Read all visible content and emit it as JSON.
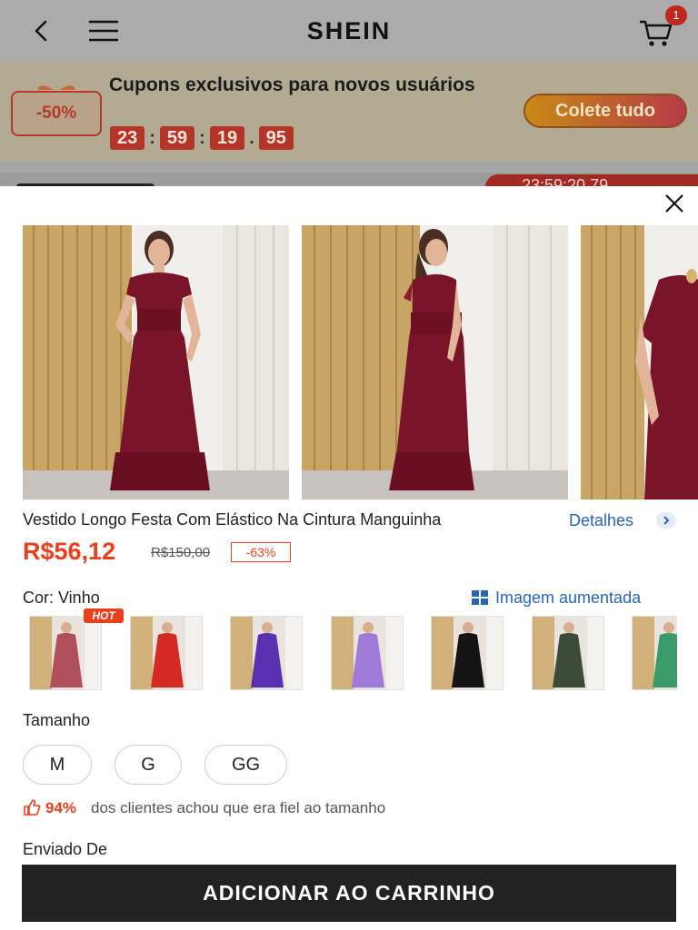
{
  "header": {
    "brand": "SHEIN",
    "cart_count": "1"
  },
  "promo": {
    "tag": "-50%",
    "title": "Cupons exclusivos para novos usuários",
    "countdown": [
      "23",
      "59",
      "19",
      "95"
    ],
    "collect_label": "Colete tudo"
  },
  "background_strip": {
    "timer_text": "23:59:20 79"
  },
  "product": {
    "title": "Vestido Longo Festa Com Elástico Na Cintura Manguinha",
    "details_label": "Detalhes",
    "price": "R$56,12",
    "old_price": "R$150,00",
    "discount": "-63%"
  },
  "color": {
    "label": "Cor: Vinho",
    "zoom_label": "Imagem aumentada",
    "hot_tag": "HOT",
    "swatches": [
      {
        "color": "#b0505c",
        "selected": false
      },
      {
        "color": "#d42a22",
        "selected": false
      },
      {
        "color": "#5a2fb0",
        "selected": false
      },
      {
        "color": "#a07ad8",
        "selected": false
      },
      {
        "color": "#141414",
        "selected": false
      },
      {
        "color": "#3c4a3a",
        "selected": false
      },
      {
        "color": "#3a9a6a",
        "selected": false
      }
    ]
  },
  "size": {
    "label": "Tamanho",
    "options": [
      "M",
      "G",
      "GG"
    ]
  },
  "fit": {
    "percent": "94%",
    "text": "dos clientes achou que era fiel ao tamanho"
  },
  "shipping": {
    "label": "Enviado De"
  },
  "cta": {
    "label": "ADICIONAR AO CARRINHO"
  },
  "colors": {
    "accent": "#e8401c",
    "link": "#2a64b8",
    "dress": "#7a1428"
  }
}
